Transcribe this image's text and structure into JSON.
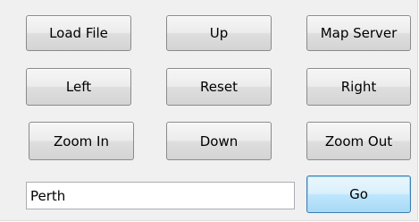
{
  "buttons": {
    "load_file": "Load File",
    "up": "Up",
    "map_server": "Map Server",
    "left": "Left",
    "reset": "Reset",
    "right": "Right",
    "zoom_in": "Zoom In",
    "down": "Down",
    "zoom_out": "Zoom Out",
    "go": "Go"
  },
  "location_input": {
    "value": "Perth"
  }
}
